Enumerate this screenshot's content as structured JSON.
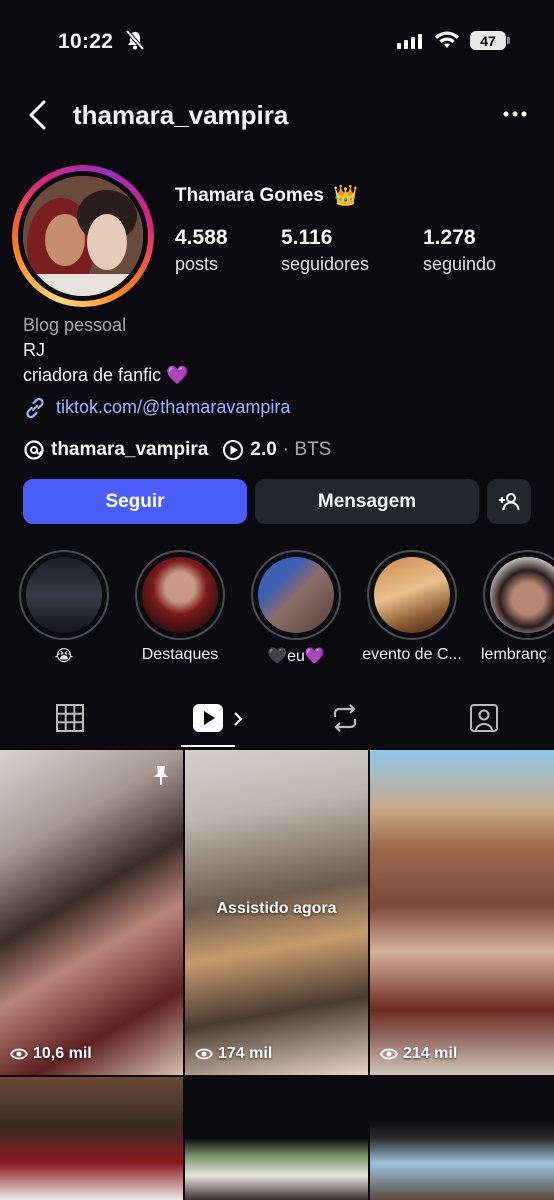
{
  "status": {
    "time": "10:22",
    "battery": "47"
  },
  "header": {
    "username": "thamara_vampira"
  },
  "profile": {
    "full_name": "Thamara Gomes",
    "crown": "👑",
    "stats": [
      {
        "value": "4.588",
        "label": "posts"
      },
      {
        "value": "5.116",
        "label": "seguidores"
      },
      {
        "value": "1.278",
        "label": "seguindo"
      }
    ],
    "category": "Blog pessoal",
    "bio_lines": [
      "RJ",
      "criadora de fanfic 💜"
    ],
    "link": "tiktok.com/@thamaravampira",
    "threads_handle": "thamara_vampira",
    "music_version": "2.0",
    "music_artist": "· BTS"
  },
  "actions": {
    "follow": "Seguir",
    "message": "Mensagem"
  },
  "highlights": [
    {
      "label": "😭"
    },
    {
      "label": "Destaques"
    },
    {
      "label": "🖤eu💜"
    },
    {
      "label": "evento de C..."
    },
    {
      "label": "lembranç"
    }
  ],
  "grid": [
    {
      "views": "10,6 mil"
    },
    {
      "overlay": "Assistido agora",
      "views": "174 mil"
    },
    {
      "views": "214 mil"
    }
  ],
  "colors": {
    "accent": "#4a5df9",
    "background": "#0b0b0f",
    "link": "#a2b4ff"
  }
}
